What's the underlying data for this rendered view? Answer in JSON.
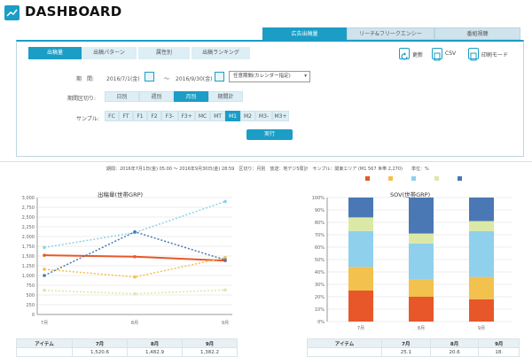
{
  "app": {
    "title": "DASHBOARD"
  },
  "main_tabs": [
    {
      "label": "広告出稿量",
      "active": true
    },
    {
      "label": "リーチ&フリークエンシー",
      "active": false
    },
    {
      "label": "番組視聴",
      "active": false
    }
  ],
  "sub_tabs": [
    {
      "label": "出稿量",
      "active": true
    },
    {
      "label": "出稿パターン",
      "active": false
    },
    {
      "label": "属性別",
      "active": false
    },
    {
      "label": "出稿ランキング",
      "active": false
    }
  ],
  "toolbar": {
    "update": "更新",
    "csv": "CSV",
    "print": "印刷モード"
  },
  "period": {
    "label": "期　間:",
    "from": "2016/7/1(金)",
    "to": "2016/9/30(金)",
    "separator": "〜",
    "mode": "任意期間(カレンダー指定)"
  },
  "unit_label": "期間区切り:",
  "units": [
    {
      "label": "日別",
      "active": false
    },
    {
      "label": "週別",
      "active": false
    },
    {
      "label": "月別",
      "active": true
    },
    {
      "label": "期間計",
      "active": false
    }
  ],
  "sample_label": "サンプル:",
  "samples": [
    {
      "label": "FC",
      "active": false
    },
    {
      "label": "FT",
      "active": false
    },
    {
      "label": "F1",
      "active": false
    },
    {
      "label": "F2",
      "active": false
    },
    {
      "label": "F3-",
      "active": false
    },
    {
      "label": "F3+",
      "active": false
    },
    {
      "label": "MC",
      "active": false
    },
    {
      "label": "MT",
      "active": false
    },
    {
      "label": "M1",
      "active": true
    },
    {
      "label": "M2",
      "active": false
    },
    {
      "label": "M3-",
      "active": false
    },
    {
      "label": "M3+",
      "active": false
    }
  ],
  "run_button": "実行",
  "summary": "期間：2016年7月1日(金) 05:00 〜 2016年9月30日(金) 28:59　区切り：月別　放送：地デジ5局計　サンプル：関東エリア (M1 567 世帯 2,270)　　単位：%",
  "colors": {
    "accent": "#1b9dc6",
    "orange": "#e8572a",
    "yellow": "#f2c14e",
    "sky": "#8fd0ec",
    "lime": "#dce9a6",
    "navy": "#4a78b5"
  },
  "legend": [
    {
      "color": "#e8572a",
      "label": ""
    },
    {
      "color": "#f2c14e",
      "label": ""
    },
    {
      "color": "#8fd0ec",
      "label": ""
    },
    {
      "color": "#dce9a6",
      "label": ""
    },
    {
      "color": "#4a78b5",
      "label": ""
    }
  ],
  "table_left": {
    "headers": [
      "アイテム",
      "7月",
      "8月",
      "9月"
    ],
    "row": [
      "",
      "1,520.6",
      "1,482.9",
      "1,382.2"
    ]
  },
  "table_right": {
    "headers": [
      "アイテム",
      "7月",
      "8月",
      "9月"
    ],
    "row": [
      "",
      "25.1",
      "20.6",
      "18."
    ]
  },
  "chart_data": [
    {
      "type": "line",
      "title": "出稿量(世帯GRP)",
      "categories": [
        "7月",
        "8月",
        "9月"
      ],
      "ylim": [
        0,
        3000
      ],
      "yticks": [
        "0",
        "250",
        "500",
        "750",
        "1,000",
        "1,250",
        "1,500",
        "1,750",
        "2,000",
        "2,250",
        "2,500",
        "2,750",
        "3,000"
      ],
      "series": [
        {
          "color": "#e8572a",
          "values": [
            1520,
            1483,
            1382
          ],
          "style": "solid"
        },
        {
          "color": "#f2c14e",
          "values": [
            1160,
            960,
            1460
          ],
          "style": "dotted"
        },
        {
          "color": "#8fd0ec",
          "values": [
            1720,
            2100,
            2900
          ],
          "style": "dotted"
        },
        {
          "color": "#dce9a6",
          "values": [
            620,
            530,
            630
          ],
          "style": "dotted"
        },
        {
          "color": "#4a78b5",
          "values": [
            1000,
            2120,
            1400
          ],
          "style": "dotted"
        }
      ]
    },
    {
      "type": "bar",
      "title": "SOV(世帯GRP)",
      "stacked": true,
      "categories": [
        "7月",
        "8月",
        "9月"
      ],
      "ylim": [
        0,
        100
      ],
      "yticks": [
        "0%",
        "10%",
        "20%",
        "30%",
        "40%",
        "50%",
        "60%",
        "70%",
        "80%",
        "90%",
        "100%"
      ],
      "series": [
        {
          "color": "#e8572a",
          "values": [
            25,
            20,
            18
          ]
        },
        {
          "color": "#f2c14e",
          "values": [
            19,
            14,
            18
          ]
        },
        {
          "color": "#8fd0ec",
          "values": [
            29,
            29,
            37
          ]
        },
        {
          "color": "#dce9a6",
          "values": [
            11,
            8,
            8
          ]
        },
        {
          "color": "#4a78b5",
          "values": [
            16,
            29,
            19
          ]
        }
      ]
    }
  ]
}
